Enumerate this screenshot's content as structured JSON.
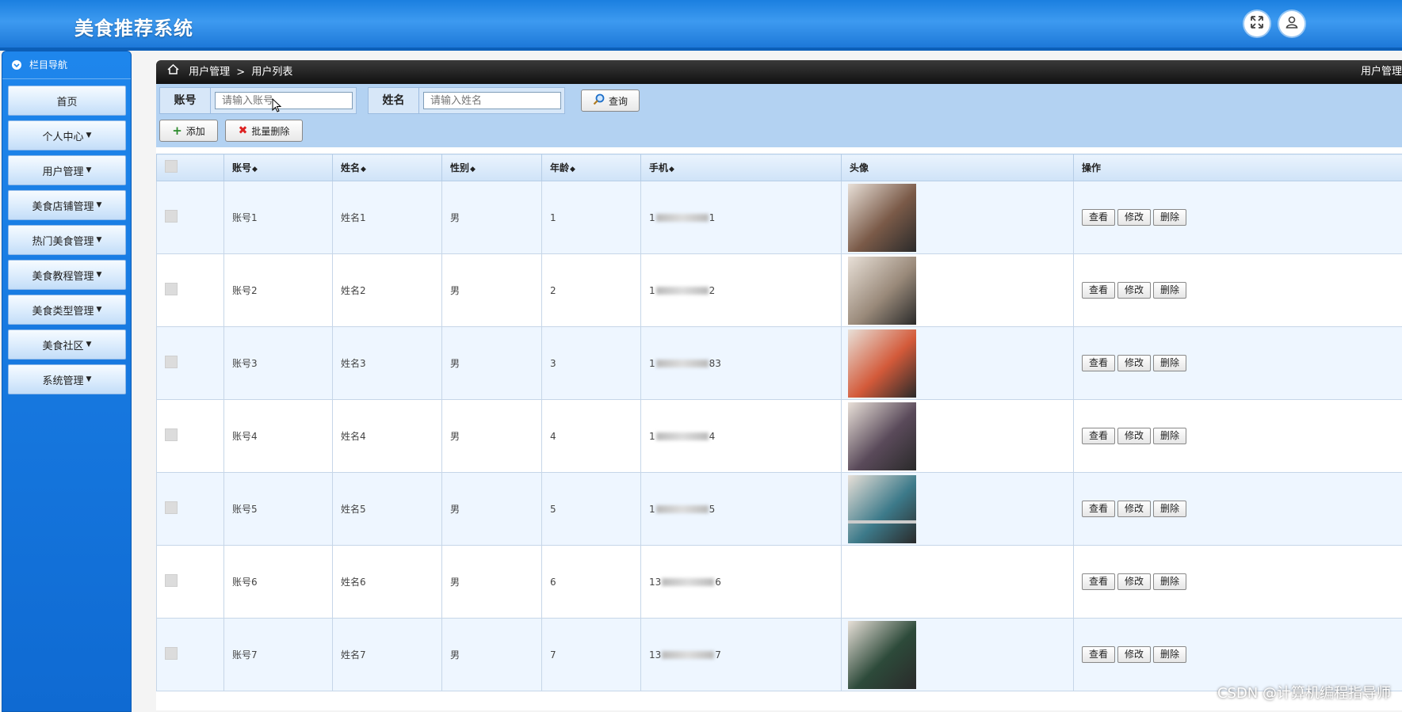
{
  "header": {
    "title": "美食推荐系统",
    "fullscreen_icon": "fullscreen-icon",
    "user_icon": "user-icon"
  },
  "sidebar": {
    "title": "栏目导航",
    "items": [
      {
        "label": "首页",
        "dropdown": false
      },
      {
        "label": "个人中心",
        "dropdown": true
      },
      {
        "label": "用户管理",
        "dropdown": true
      },
      {
        "label": "美食店铺管理",
        "dropdown": true
      },
      {
        "label": "热门美食管理",
        "dropdown": true
      },
      {
        "label": "美食教程管理",
        "dropdown": true
      },
      {
        "label": "美食类型管理",
        "dropdown": true
      },
      {
        "label": "美食社区",
        "dropdown": true
      },
      {
        "label": "系统管理",
        "dropdown": true
      }
    ]
  },
  "breadcrumb": {
    "level1": "用户管理",
    "separator": ">",
    "level2": "用户列表",
    "right_text": "用户管理"
  },
  "search": {
    "account_label": "账号",
    "account_placeholder": "请输入账号",
    "name_label": "姓名",
    "name_placeholder": "请输入姓名",
    "query_button": "查询",
    "add_button": "添加",
    "batch_delete_button": "批量删除"
  },
  "table": {
    "columns": [
      "账号",
      "姓名",
      "性别",
      "年龄",
      "手机",
      "头像",
      "操作"
    ],
    "actions": {
      "view": "查看",
      "edit": "修改",
      "delete": "删除"
    },
    "rows": [
      {
        "account": "账号1",
        "name": "姓名1",
        "gender": "男",
        "age": "1",
        "phone_prefix": "1",
        "phone_suffix": "1",
        "avatar": "#7a5a48"
      },
      {
        "account": "账号2",
        "name": "姓名2",
        "gender": "男",
        "age": "2",
        "phone_prefix": "1",
        "phone_suffix": "2",
        "avatar": "#9a8a7a"
      },
      {
        "account": "账号3",
        "name": "姓名3",
        "gender": "男",
        "age": "3",
        "phone_prefix": "1",
        "phone_suffix": "83",
        "avatar": "#d35a3a"
      },
      {
        "account": "账号4",
        "name": "姓名4",
        "gender": "男",
        "age": "4",
        "phone_prefix": "1",
        "phone_suffix": "4",
        "avatar": "#5a4a5a"
      },
      {
        "account": "账号5",
        "name": "姓名5",
        "gender": "男",
        "age": "5",
        "phone_prefix": "1",
        "phone_suffix": "5",
        "avatar": "#3d7a8a"
      },
      {
        "account": "账号6",
        "name": "姓名6",
        "gender": "男",
        "age": "6",
        "phone_prefix": "13",
        "phone_suffix": "6",
        "avatar": ""
      },
      {
        "account": "账号7",
        "name": "姓名7",
        "gender": "男",
        "age": "7",
        "phone_prefix": "13",
        "phone_suffix": "7",
        "avatar": "#2d4a3a"
      }
    ]
  },
  "watermark": "CSDN @计算机编程指导师"
}
